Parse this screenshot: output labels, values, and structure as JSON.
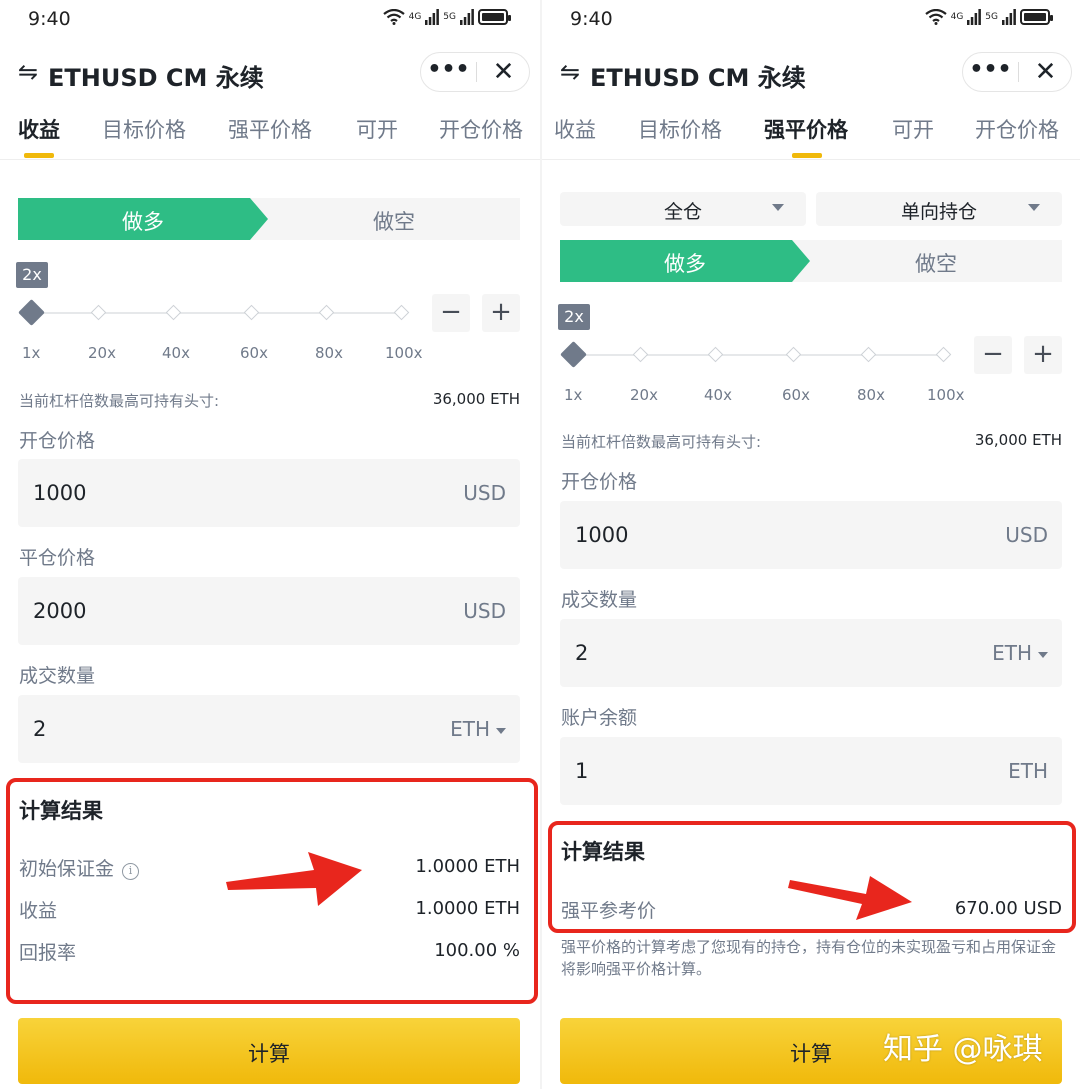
{
  "left": {
    "status": {
      "time": "9:40",
      "net1": "4G",
      "net2": "5G"
    },
    "title": "ETHUSD CM 永续",
    "tabs": [
      "收益",
      "目标价格",
      "强平价格",
      "可开",
      "开仓价格"
    ],
    "active_tab": "收益",
    "side": {
      "long": "做多",
      "short": "做空"
    },
    "leverage": {
      "current": "2x",
      "ticks": [
        "1x",
        "20x",
        "40x",
        "60x",
        "80x",
        "100x"
      ],
      "minus": "−",
      "plus": "+"
    },
    "max_position": {
      "label": "当前杠杆倍数最高可持有头寸:",
      "value": "36,000 ETH"
    },
    "fields": [
      {
        "label": "开仓价格",
        "value": "1000",
        "unit": "USD"
      },
      {
        "label": "平仓价格",
        "value": "2000",
        "unit": "USD"
      },
      {
        "label": "成交数量",
        "value": "2",
        "unit": "ETH"
      }
    ],
    "result": {
      "title": "计算结果",
      "rows": [
        {
          "label": "初始保证金",
          "value": "1.0000 ETH"
        },
        {
          "label": "收益",
          "value": "1.0000 ETH"
        },
        {
          "label": "回报率",
          "value": "100.00 %"
        }
      ]
    },
    "button": "计算"
  },
  "right": {
    "status": {
      "time": "9:40",
      "net1": "4G",
      "net2": "5G"
    },
    "title": "ETHUSD CM 永续",
    "tabs": [
      "收益",
      "目标价格",
      "强平价格",
      "可开",
      "开仓价格"
    ],
    "active_tab": "强平价格",
    "margin_mode": "全仓",
    "position_mode": "单向持仓",
    "side": {
      "long": "做多",
      "short": "做空"
    },
    "leverage": {
      "current": "2x",
      "ticks": [
        "1x",
        "20x",
        "40x",
        "60x",
        "80x",
        "100x"
      ],
      "minus": "−",
      "plus": "+"
    },
    "max_position": {
      "label": "当前杠杆倍数最高可持有头寸:",
      "value": "36,000 ETH"
    },
    "fields": [
      {
        "label": "开仓价格",
        "value": "1000",
        "unit": "USD"
      },
      {
        "label": "成交数量",
        "value": "2",
        "unit": "ETH"
      },
      {
        "label": "账户余额",
        "value": "1",
        "unit": "ETH"
      }
    ],
    "result": {
      "title": "计算结果",
      "rows": [
        {
          "label": "强平参考价",
          "value": "670.00 USD"
        }
      ]
    },
    "note": "强平价格的计算考虑了您现有的持仓，持有仓位的未实现盈亏和占用保证金将影响强平价格计算。",
    "button": "计算"
  },
  "watermark": "知乎 @咏琪",
  "colors": {
    "long_green": "#2ebd85",
    "accent_yellow": "#f0b90b",
    "highlight_red": "#e8261d",
    "muted_text": "#707a8a"
  }
}
